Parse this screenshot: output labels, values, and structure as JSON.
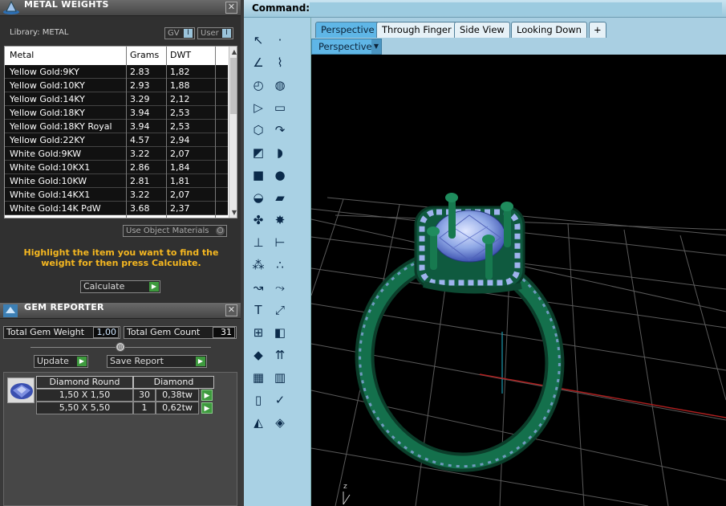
{
  "metal_panel": {
    "title": "METAL WEIGHTS",
    "library_label": "Library: METAL",
    "gv_label": "GV",
    "user_label": "User",
    "columns": [
      "Metal",
      "Grams",
      "DWT"
    ],
    "rows": [
      {
        "metal": "Yellow Gold:9KY",
        "grams": "2.83",
        "dwt": "1,82"
      },
      {
        "metal": "Yellow Gold:10KY",
        "grams": "2.93",
        "dwt": "1,88"
      },
      {
        "metal": "Yellow Gold:14KY",
        "grams": "3.29",
        "dwt": "2,12"
      },
      {
        "metal": "Yellow Gold:18KY",
        "grams": "3.94",
        "dwt": "2,53"
      },
      {
        "metal": "Yellow Gold:18KY Royal",
        "grams": "3.94",
        "dwt": "2,53"
      },
      {
        "metal": "Yellow Gold:22KY",
        "grams": "4.57",
        "dwt": "2,94"
      },
      {
        "metal": "White Gold:9KW",
        "grams": "3.22",
        "dwt": "2,07"
      },
      {
        "metal": "White Gold:10KX1",
        "grams": "2.86",
        "dwt": "1,84"
      },
      {
        "metal": "White Gold:10KW",
        "grams": "2.81",
        "dwt": "1,81"
      },
      {
        "metal": "White Gold:14KX1",
        "grams": "3.22",
        "dwt": "2,07"
      },
      {
        "metal": "White Gold:14K PdW",
        "grams": "3.68",
        "dwt": "2,37"
      }
    ],
    "use_object_materials": "Use Object Materials",
    "instruction": "Highlight the item you want to find the weight for then press Calculate.",
    "calculate_label": "Calculate"
  },
  "gem_panel": {
    "title": "GEM REPORTER",
    "total_weight_label": "Total Gem Weight",
    "total_weight_value": "1,00",
    "total_count_label": "Total Gem Count",
    "total_count_value": "31",
    "update_label": "Update",
    "save_report_label": "Save Report",
    "header_shape": "Diamond Round",
    "header_material": "Diamond",
    "gems": [
      {
        "size": "1,50 X 1,50",
        "count": "30",
        "weight": "0,38tw"
      },
      {
        "size": "5,50 X 5,50",
        "count": "1",
        "weight": "0,62tw"
      }
    ]
  },
  "command": {
    "label": "Command:"
  },
  "viewport_tabs": [
    "Perspective",
    "Through Finger",
    "Side View",
    "Looking Down"
  ],
  "add_tab_label": "+",
  "viewport_label": "Perspective",
  "axis_label": "z",
  "colors": {
    "accent": "#5fb6e6",
    "ring": "#0f5a3f",
    "gem": "#8fa8e6",
    "go_button": "#3e9a3e"
  }
}
